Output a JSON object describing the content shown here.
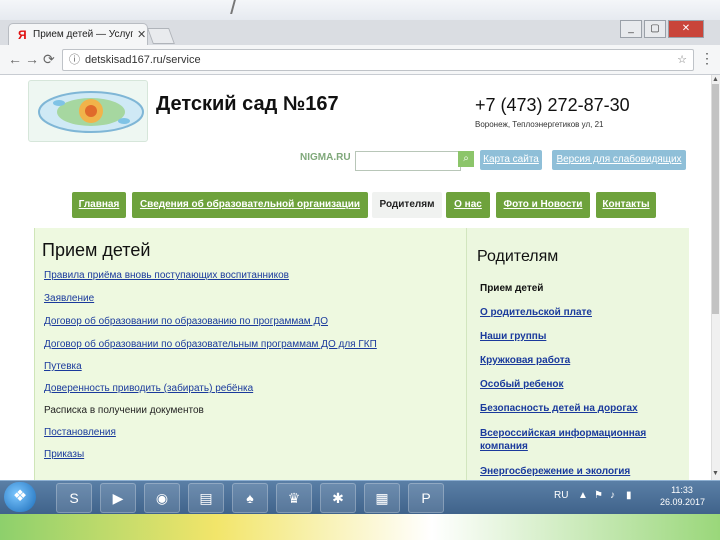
{
  "browser": {
    "tab_title": "Прием детей — Услуги",
    "tab_close": "✕",
    "url": "detskisad167.ru/service",
    "window": {
      "min": "_",
      "max": "▢",
      "close": "✕"
    }
  },
  "site": {
    "title": "Детский сад №167",
    "phone": "+7 (473) 272-87-30",
    "address": "Воронеж, Теплоэнергетиков ул, 21",
    "search_logo": "NIGMA.RU",
    "search_placeholder": "",
    "top_buttons": [
      "Карта сайта",
      "Версия для слабовидящих"
    ],
    "nav": [
      "Главная",
      "Сведения об образовательной организации",
      "Родителям",
      "О нас",
      "Фото и Новости",
      "Контакты"
    ]
  },
  "content": {
    "heading": "Прием детей",
    "links": [
      "Правила приёма вновь поступающих воспитанников",
      "Заявление",
      "Договор об образовании по образованию по программам ДО",
      "Договор об образовании по образовательным программам ДО для ГКП",
      "Путевка",
      "Доверенность приводить (забирать) ребёнка",
      "Расписка в получении документов",
      "Постановления",
      "Приказы"
    ]
  },
  "sidebar": {
    "heading": "Родителям",
    "items": [
      "Прием детей",
      "О родительской плате",
      "Наши группы",
      "Кружковая работа",
      "Особый ребенок",
      "Безопасность детей на дорогах",
      "Всероссийская информационная компания",
      "Энергосбережение и экология"
    ]
  },
  "taskbar": {
    "lang": "RU",
    "time": "11:33",
    "date": "26.09.2017"
  },
  "colors": {
    "nav_green": "#6ea23c",
    "top_button_blue": "#8fbfd8",
    "content_bg": "#eef9e0",
    "link_blue": "#1a3a9c"
  }
}
